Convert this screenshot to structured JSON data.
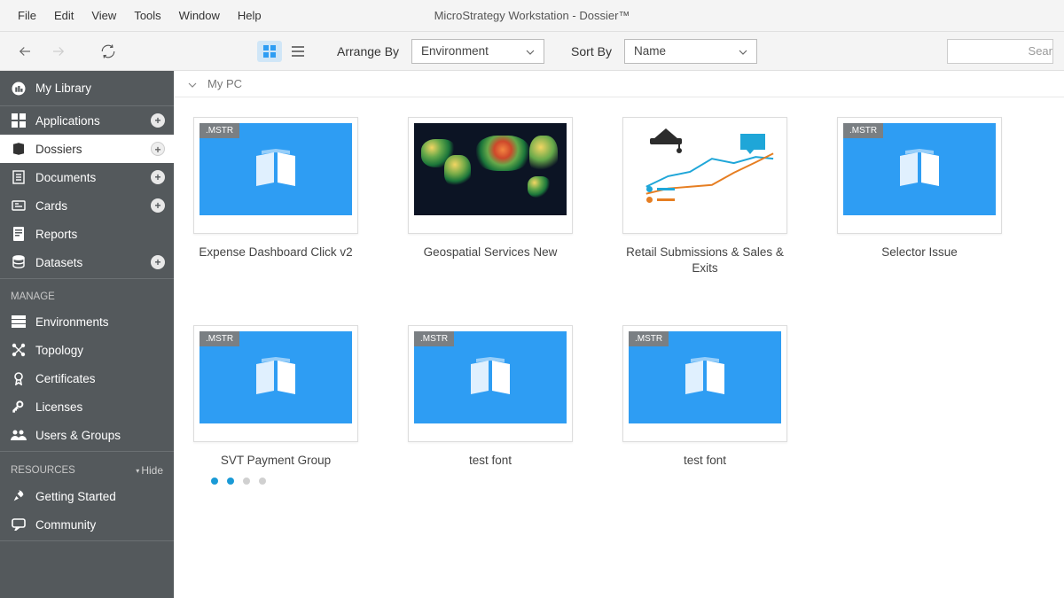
{
  "app_title": "MicroStrategy Workstation - Dossier™",
  "menu": {
    "file": "File",
    "edit": "Edit",
    "view": "View",
    "tools": "Tools",
    "window": "Window",
    "help": "Help"
  },
  "toolbar": {
    "arrange_by_label": "Arrange By",
    "arrange_by_value": "Environment",
    "sort_by_label": "Sort By",
    "sort_by_value": "Name",
    "search_placeholder": "Sear"
  },
  "sidebar": {
    "library": "My Library",
    "section1": [
      {
        "label": "Applications",
        "plus": true
      },
      {
        "label": "Dossiers",
        "plus": true,
        "selected": true
      },
      {
        "label": "Documents",
        "plus": true
      },
      {
        "label": "Cards",
        "plus": true
      },
      {
        "label": "Reports",
        "plus": false
      },
      {
        "label": "Datasets",
        "plus": true
      }
    ],
    "manage_label": "MANAGE",
    "manage": [
      {
        "label": "Environments"
      },
      {
        "label": "Topology"
      },
      {
        "label": "Certificates"
      },
      {
        "label": "Licenses"
      },
      {
        "label": "Users & Groups"
      }
    ],
    "resources_label": "RESOURCES",
    "hide_label": "Hide",
    "resources": [
      {
        "label": "Getting Started"
      },
      {
        "label": "Community"
      }
    ]
  },
  "breadcrumb": {
    "location": "My PC"
  },
  "cards": [
    {
      "title": "Expense Dashboard Click v2",
      "badge": ".MSTR",
      "thumb": "book"
    },
    {
      "title": "Geospatial Services New",
      "badge": null,
      "thumb": "world"
    },
    {
      "title": "Retail Submissions & Sales & Exits",
      "badge": null,
      "thumb": "analytics"
    },
    {
      "title": "Selector Issue",
      "badge": ".MSTR",
      "thumb": "book"
    },
    {
      "title": "SVT Payment Group",
      "badge": ".MSTR",
      "thumb": "book"
    },
    {
      "title": "test font",
      "badge": ".MSTR",
      "thumb": "book"
    },
    {
      "title": "test font",
      "badge": ".MSTR",
      "thumb": "book"
    }
  ]
}
